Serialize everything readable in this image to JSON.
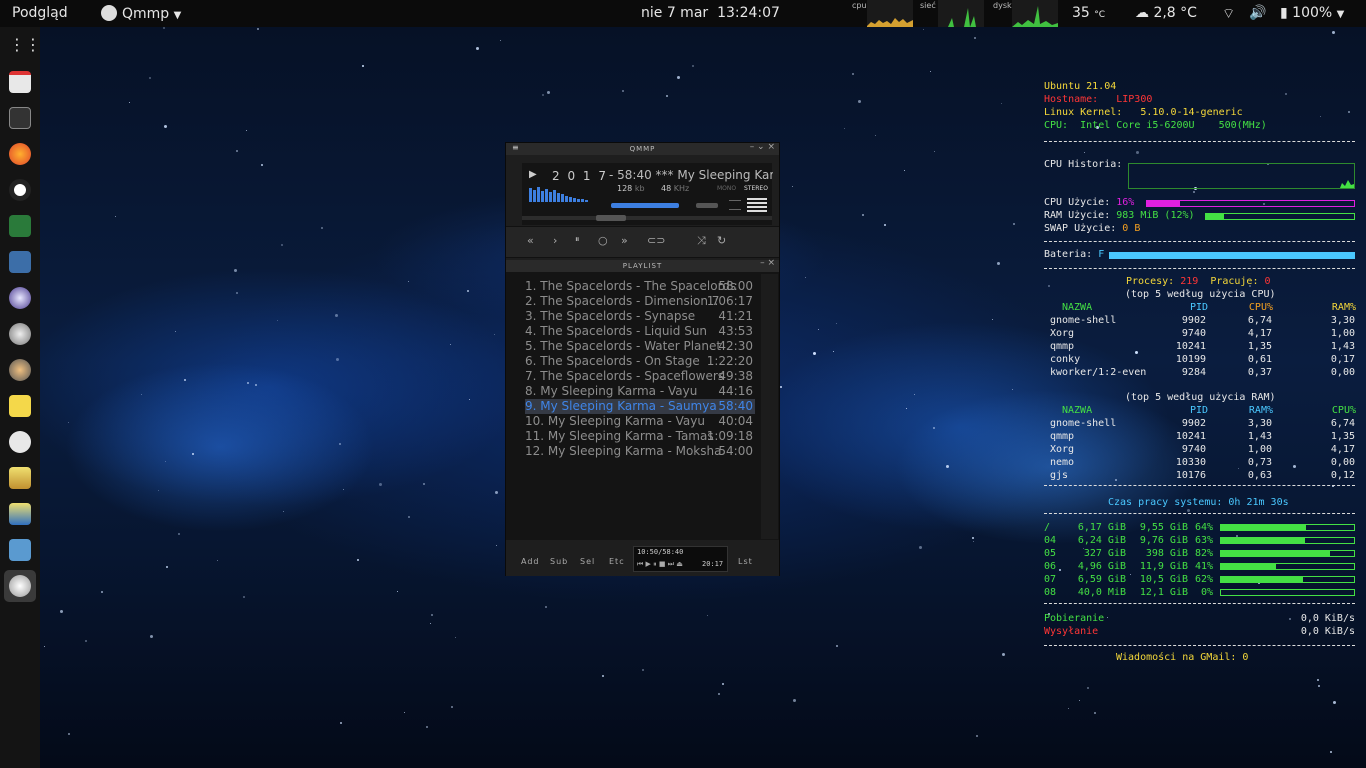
{
  "topbar": {
    "activities": "Podgląd",
    "app_name": "Qmmp",
    "date": "nie 7 mar",
    "time": "13:24:07",
    "mon_cpu": "cpu",
    "mon_net": "sieć",
    "mon_disk": "dysk",
    "temp": "35",
    "temp_unit": "°C",
    "weather": "2,8 °C",
    "battery": "100%"
  },
  "dock": {
    "items": [
      "grid-icon",
      "calendar-icon",
      "terminal-icon",
      "firefox-icon",
      "obs-icon",
      "media-icon",
      "calculator-icon",
      "eye-icon",
      "disk-icon",
      "user-icon",
      "notes-icon",
      "clock-icon",
      "image-icon",
      "image2-icon",
      "folder-icon",
      "qmmp-icon"
    ]
  },
  "qmmp": {
    "title": "QMMP",
    "counter": "2 0 1 7",
    "now": "- 58:40  *** My Sleeping Kar",
    "bitrate": "128",
    "kbps": "kb",
    "freq": "48",
    "khz": "KHz",
    "mono": "MONO",
    "stereo": "STEREO",
    "playlist_title": "PLAYLIST",
    "playlist": [
      {
        "title": "1. The Spacelords - The Spacelords",
        "time": "58:00"
      },
      {
        "title": "2. The Spacelords - Dimension 7",
        "time": "1:06:17"
      },
      {
        "title": "3. The Spacelords - Synapse",
        "time": "41:21"
      },
      {
        "title": "4. The Spacelords - Liquid Sun",
        "time": "43:53"
      },
      {
        "title": "5. The Spacelords - Water Planet",
        "time": "42:30"
      },
      {
        "title": "6. The Spacelords - On Stage",
        "time": "1:22:20"
      },
      {
        "title": "7. The Spacelords - Spaceflowers",
        "time": "49:38"
      },
      {
        "title": "8. My Sleeping Karma - Vayu",
        "time": "44:16"
      },
      {
        "title": "9. My Sleeping Karma - Saumya",
        "time": "58:40"
      },
      {
        "title": "10. My Sleeping Karma - Vayu",
        "time": "40:04"
      },
      {
        "title": "11. My Sleeping Karma - Tamas",
        "time": "1:09:18"
      },
      {
        "title": "12. My Sleeping Karma - Moksha",
        "time": "54:00"
      }
    ],
    "bottom": {
      "add": "Add",
      "sub": "Sub",
      "sel": "Sel",
      "etc": "Etc",
      "lst": "Lst",
      "pos": "10:50/58:40",
      "total": "20:17"
    }
  },
  "conky": {
    "os": "Ubuntu 21.04",
    "hostname_label": "Hostname:",
    "hostname": "LIP300",
    "kernel_label": "Linux Kernel:",
    "kernel": "5.10.0-14-generic",
    "cpu_label": "CPU:",
    "cpu_model": "Intel Core i5-6200U",
    "cpu_freq": "500(MHz)",
    "cpu_hist": "CPU Historia:",
    "cpu_use_label": "CPU  Użycie:",
    "cpu_use": "16%",
    "cpu_use_frac": 0.16,
    "ram_use_label": "RAM  Użycie:",
    "ram_use": "983 MiB (12%)",
    "ram_use_frac": 0.12,
    "swap_label": "SWAP Użycie:",
    "swap": "0 B",
    "battery_label": "Bateria:",
    "battery": "F",
    "battery_frac": 1.0,
    "proc_label": "Procesy:",
    "proc": "219",
    "run_label": "Pracuje:",
    "run": "0",
    "top_cpu_title": "(top 5 według użycia CPU)",
    "top_ram_title": "(top 5 według użycia RAM)",
    "h_name": "NAZWA",
    "h_pid": "PID",
    "h_cpu": "CPU%",
    "h_ram": "RAM%",
    "top_cpu": [
      {
        "name": "gnome-shell",
        "pid": "9902",
        "a": "6,74",
        "b": "3,30"
      },
      {
        "name": "Xorg",
        "pid": "9740",
        "a": "4,17",
        "b": "1,00"
      },
      {
        "name": "qmmp",
        "pid": "10241",
        "a": "1,35",
        "b": "1,43"
      },
      {
        "name": "conky",
        "pid": "10199",
        "a": "0,61",
        "b": "0,17"
      },
      {
        "name": "kworker/1:2-even",
        "pid": "9284",
        "a": "0,37",
        "b": "0,00"
      }
    ],
    "top_ram": [
      {
        "name": "gnome-shell",
        "pid": "9902",
        "a": "3,30",
        "b": "6,74"
      },
      {
        "name": "qmmp",
        "pid": "10241",
        "a": "1,43",
        "b": "1,35"
      },
      {
        "name": "Xorg",
        "pid": "9740",
        "a": "1,00",
        "b": "4,17"
      },
      {
        "name": "nemo",
        "pid": "10330",
        "a": "0,73",
        "b": "0,00"
      },
      {
        "name": "gjs",
        "pid": "10176",
        "a": "0,63",
        "b": "0,12"
      }
    ],
    "uptime": "Czas pracy systemu: 0h 21m 30s",
    "disks": [
      {
        "mnt": "/",
        "used": "6,17 GiB",
        "size": "9,55 GiB",
        "pct": "64%",
        "frac": 0.64
      },
      {
        "mnt": "04",
        "used": "6,24 GiB",
        "size": "9,76 GiB",
        "pct": "63%",
        "frac": 0.63
      },
      {
        "mnt": "05",
        "used": "327 GiB",
        "size": "398 GiB",
        "pct": "82%",
        "frac": 0.82
      },
      {
        "mnt": "06",
        "used": "4,96 GiB",
        "size": "11,9 GiB",
        "pct": "41%",
        "frac": 0.41
      },
      {
        "mnt": "07",
        "used": "6,59 GiB",
        "size": "10,5 GiB",
        "pct": "62%",
        "frac": 0.62
      },
      {
        "mnt": "08",
        "used": "40,0 MiB",
        "size": "12,1 GiB",
        "pct": "0%",
        "frac": 0.0
      }
    ],
    "down_label": "Pobieranie",
    "down": "0,0 KiB/s",
    "up_label": "Wysyłanie",
    "up": "0,0 KiB/s",
    "gmail": "Wiadomości na GMail: 0"
  }
}
